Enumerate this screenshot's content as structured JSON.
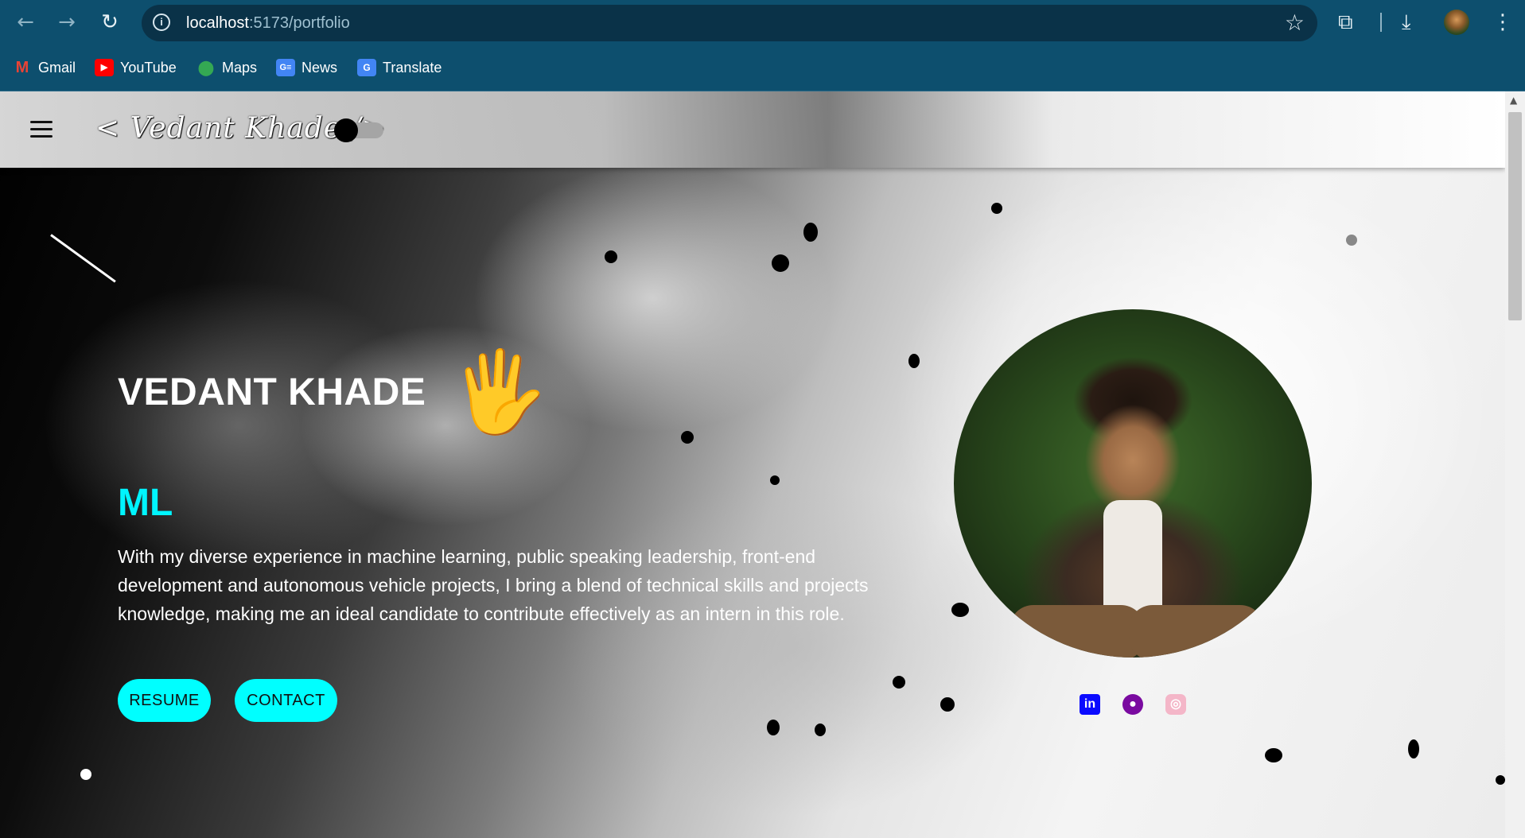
{
  "browser": {
    "url_host": "localhost",
    "url_path": ":5173/portfolio",
    "bookmarks": [
      {
        "label": "Gmail",
        "icon": "gmail-icon"
      },
      {
        "label": "YouTube",
        "icon": "youtube-icon"
      },
      {
        "label": "Maps",
        "icon": "maps-icon"
      },
      {
        "label": "News",
        "icon": "news-icon"
      },
      {
        "label": "Translate",
        "icon": "translate-icon"
      }
    ]
  },
  "header": {
    "logo": "< Vedant Khade />",
    "theme_toggle": "dark"
  },
  "hero": {
    "name": "VEDANT KHADE",
    "wave": "🖐",
    "role": "ML",
    "bio": "With my diverse experience in machine learning, public speaking leadership, front-end development and autonomous vehicle projects, I bring a blend of technical skills and projects knowledge, making me an ideal candidate to contribute effectively as an intern in this role.",
    "buttons": {
      "resume": "RESUME",
      "contact": "CONTACT"
    }
  },
  "social": [
    "linkedin-icon",
    "github-icon",
    "instagram-icon"
  ],
  "colors": {
    "accent": "#00ffff",
    "role_text": "#00f5ff",
    "linkedin": "#0a0aff",
    "github": "#7a0aa0",
    "instagram": "#f4b6c8",
    "chrome": "#0d4f6e"
  }
}
